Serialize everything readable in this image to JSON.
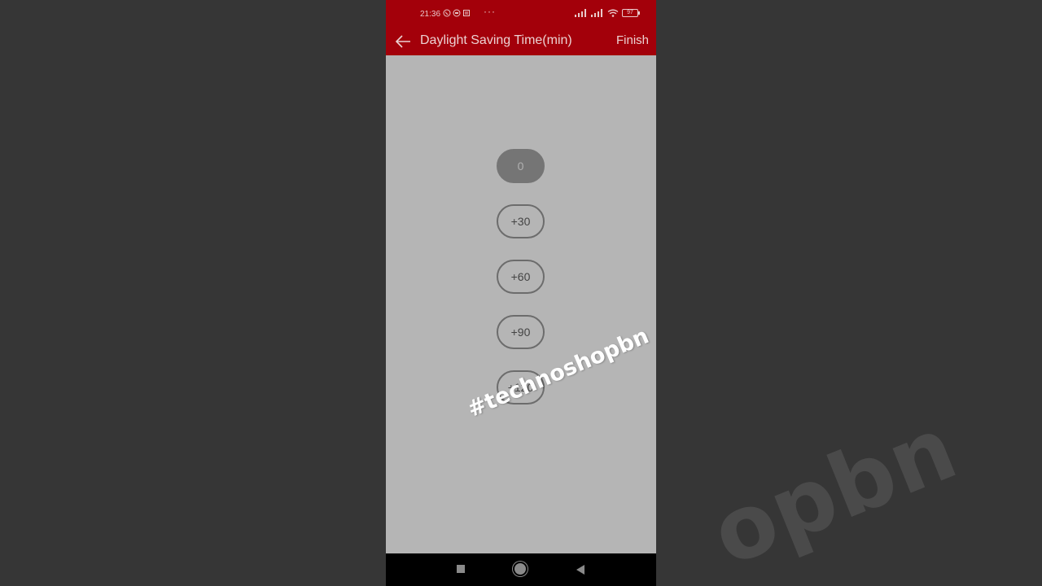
{
  "status_bar": {
    "time": "21:36",
    "more": "···",
    "battery": "97"
  },
  "app_bar": {
    "title": "Daylight Saving Time(min)",
    "finish_label": "Finish"
  },
  "options": [
    {
      "label": "0",
      "selected": true
    },
    {
      "label": "+30",
      "selected": false
    },
    {
      "label": "+60",
      "selected": false
    },
    {
      "label": "+90",
      "selected": false
    },
    {
      "label": "+120",
      "selected": false
    }
  ],
  "watermark": "#technoshopbn",
  "background_watermark": "opbn",
  "colors": {
    "header": "#a3000a",
    "content_bg": "#b5b5b5",
    "selected_pill": "#757575",
    "outside_bg": "#363636"
  }
}
